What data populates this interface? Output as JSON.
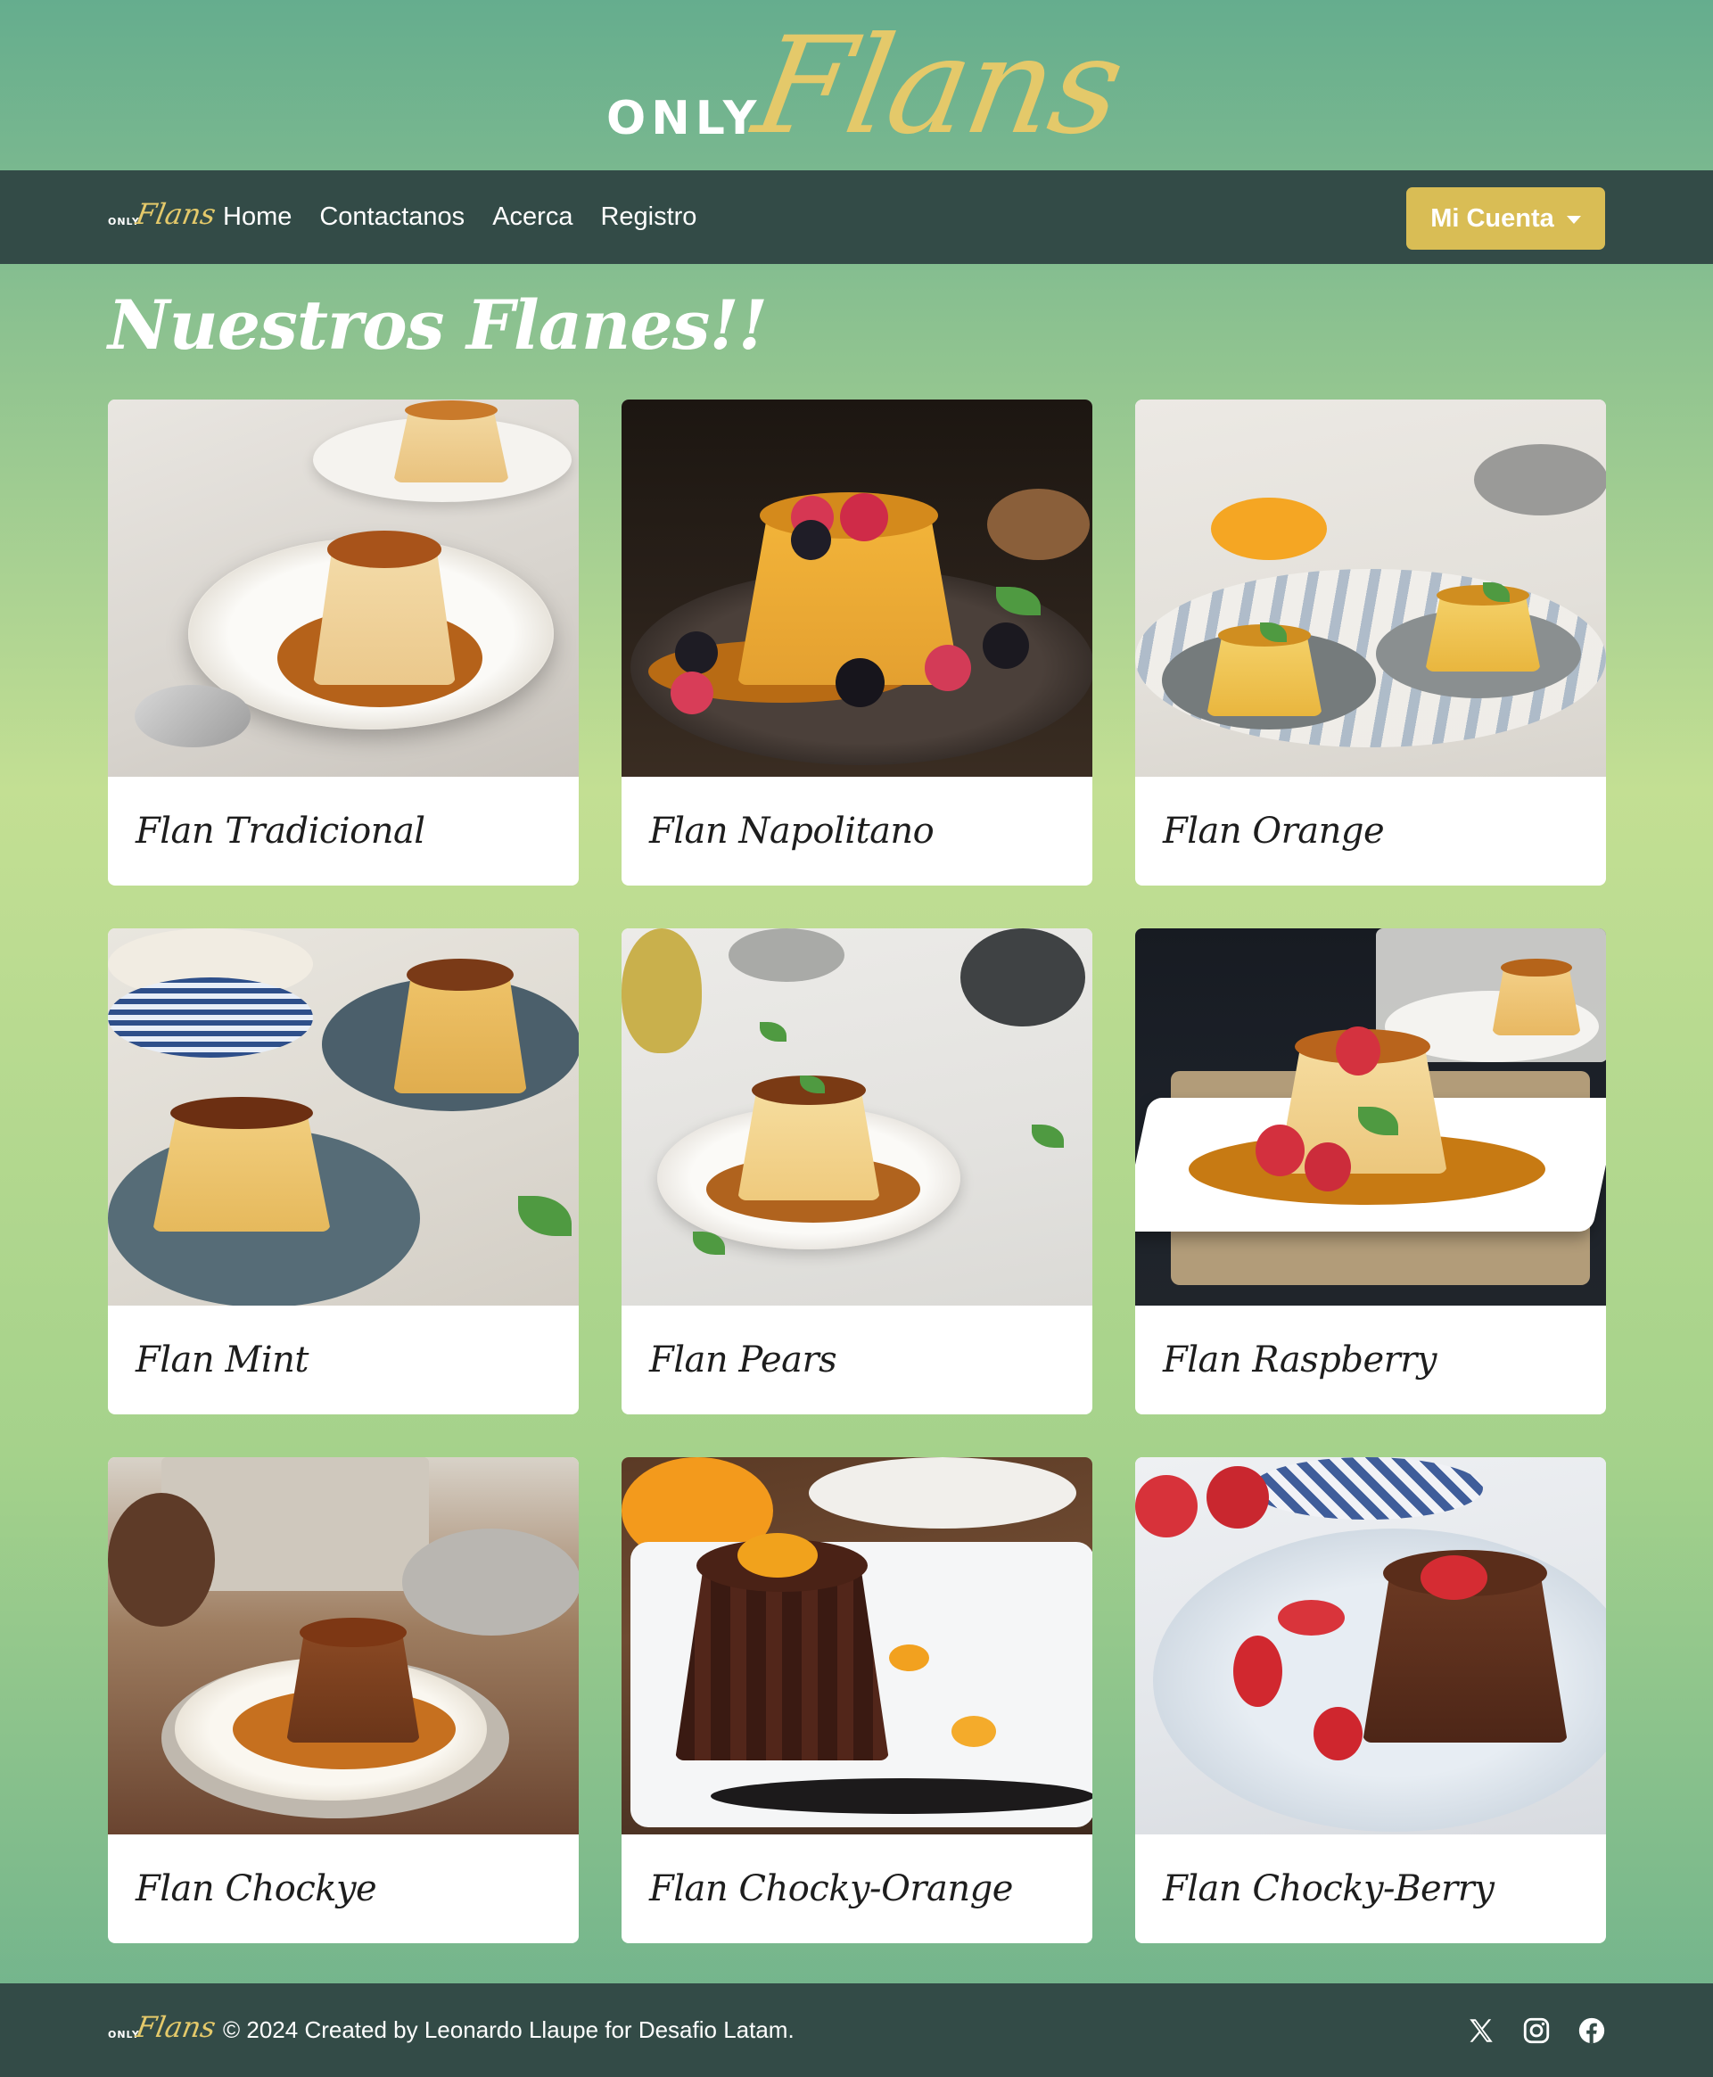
{
  "brand": {
    "only": "ONLY",
    "flans": "Flans"
  },
  "nav": {
    "links": [
      "Home",
      "Contactanos",
      "Acerca",
      "Registro"
    ],
    "account_label": "Mi Cuenta"
  },
  "main": {
    "title": "Nuestros Flanes!!",
    "cards": [
      {
        "title": "Flan Tradicional"
      },
      {
        "title": "Flan Napolitano"
      },
      {
        "title": "Flan Orange"
      },
      {
        "title": "Flan Mint"
      },
      {
        "title": "Flan Pears"
      },
      {
        "title": "Flan Raspberry"
      },
      {
        "title": "Flan Chockye"
      },
      {
        "title": "Flan Chocky-Orange"
      },
      {
        "title": "Flan Chocky-Berry"
      }
    ]
  },
  "footer": {
    "text": "© 2024 Created by Leonardo Llaupe for Desafio Latam.",
    "socials": [
      "x-icon",
      "instagram-icon",
      "facebook-icon"
    ]
  },
  "colors": {
    "navbar": "#334b47",
    "accent_gold": "#d9bd55",
    "logo_gold": "#e4c96a",
    "bg_green_top": "#65ad8e",
    "bg_green_mid": "#c3df93"
  }
}
